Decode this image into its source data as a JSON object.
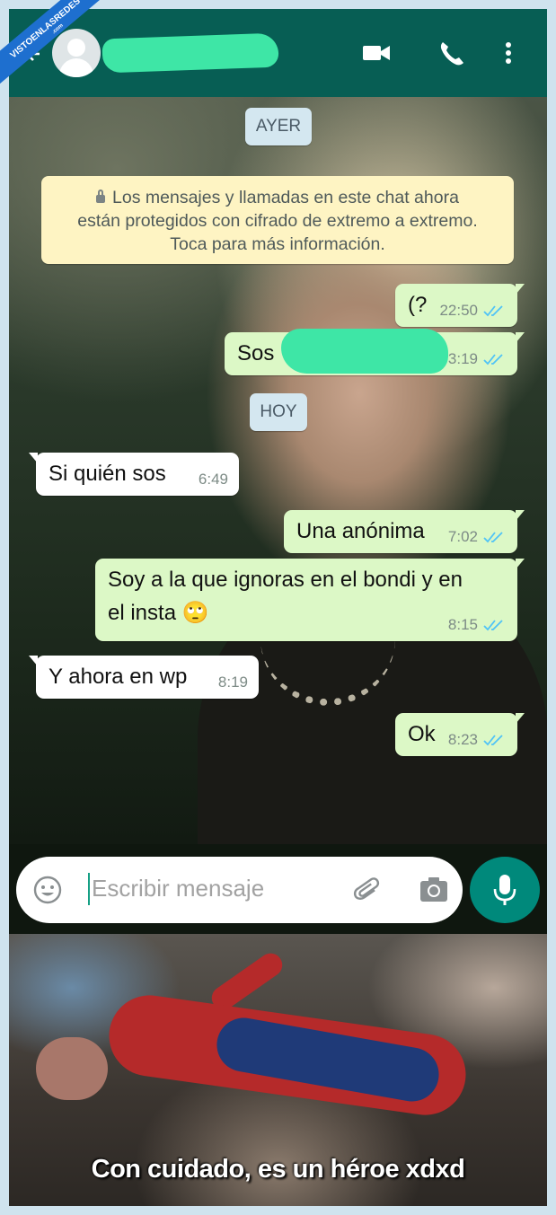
{
  "header": {
    "contact_name": "",
    "icons": [
      "back-arrow-icon",
      "avatar-placeholder",
      "video-call-icon",
      "phone-icon",
      "more-vert-icon"
    ]
  },
  "chat": {
    "date_ayer": "AYER",
    "notice": {
      "line1": "Los mensajes y llamadas en este chat ahora",
      "line2": "están protegidos con cifrado de extremo a extremo.",
      "line3": "Toca para más información."
    },
    "date_hoy": "HOY",
    "messages": [
      {
        "dir": "out",
        "text": "(?",
        "time": "22:50",
        "read": true
      },
      {
        "dir": "out",
        "text": "Sos",
        "time": "23:19",
        "time_visible": "3:19",
        "read": true
      },
      {
        "dir": "in",
        "text": "Si quién sos",
        "time": "6:49"
      },
      {
        "dir": "out",
        "text": "Una anónima",
        "time": "7:02",
        "read": true
      },
      {
        "dir": "out",
        "text_line1": "Soy a la que ignoras en el bondi y en",
        "text_line2": "el insta 🙄",
        "time": "8:15",
        "read": true
      },
      {
        "dir": "in",
        "text": "Y ahora en wp",
        "time": "8:19"
      },
      {
        "dir": "out",
        "text": "Ok",
        "time": "8:23",
        "read": true
      }
    ]
  },
  "input": {
    "placeholder": "Escribir mensaje",
    "icons": [
      "emoji-icon",
      "attach-icon",
      "camera-icon",
      "mic-icon"
    ]
  },
  "meme": {
    "caption": "Con cuidado, es un héroe xdxd"
  },
  "watermark": {
    "text": "VISTOENLASREDES",
    "suffix": ".com"
  },
  "colors": {
    "header": "#075e54",
    "outgoing_bubble": "#dcf8c6",
    "incoming_bubble": "#ffffff",
    "notice_bg": "#fef4c3",
    "date_pill": "#d4e7f0",
    "read_ticks": "#4fc3f7",
    "mic_button": "#00897b",
    "redaction": "#3ee6a6"
  }
}
